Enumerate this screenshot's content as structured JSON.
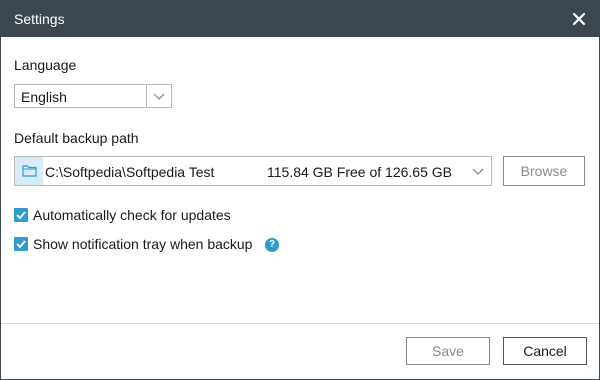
{
  "window": {
    "title": "Settings"
  },
  "language": {
    "label": "Language",
    "selected": "English"
  },
  "backup": {
    "label": "Default backup path",
    "path": "C:\\Softpedia\\Softpedia Test",
    "free_space": "115.84 GB Free of 126.65 GB",
    "browse_label": "Browse"
  },
  "options": [
    {
      "label": "Automatically check for updates",
      "checked": true
    },
    {
      "label": "Show notification tray when backup",
      "checked": true
    }
  ],
  "footer": {
    "save_label": "Save",
    "cancel_label": "Cancel"
  },
  "colors": {
    "titlebar": "#3c4750",
    "accent": "#2e9ccf",
    "folder_highlight": "#d7ecf7"
  },
  "icons": {
    "close": "close-icon",
    "folder": "folder-icon",
    "dropdown": "chevron-down-icon",
    "checkbox": "checkmark-icon",
    "help": "help-icon"
  }
}
